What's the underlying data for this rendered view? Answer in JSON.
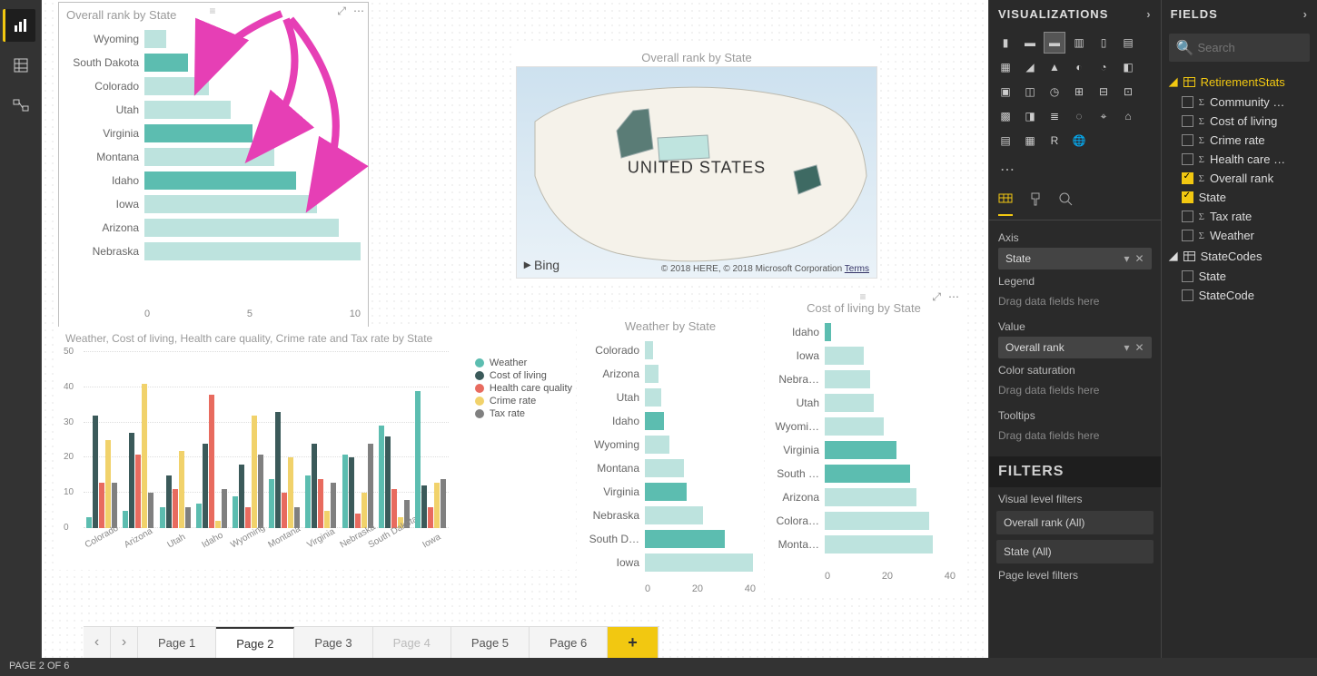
{
  "statusbar": {
    "text": "PAGE 2 OF 6"
  },
  "pages": {
    "items": [
      {
        "label": "Page 1",
        "active": false,
        "disabled": false
      },
      {
        "label": "Page 2",
        "active": true,
        "disabled": false
      },
      {
        "label": "Page 3",
        "active": false,
        "disabled": false
      },
      {
        "label": "Page 4",
        "active": false,
        "disabled": true
      },
      {
        "label": "Page 5",
        "active": false,
        "disabled": false
      },
      {
        "label": "Page 6",
        "active": false,
        "disabled": false
      }
    ],
    "add_label": "+"
  },
  "viz_panel": {
    "title": "VISUALIZATIONS",
    "axis_label": "Axis",
    "axis_field": "State",
    "legend_label": "Legend",
    "legend_placeholder": "Drag data fields here",
    "value_label": "Value",
    "value_field": "Overall rank",
    "sat_label": "Color saturation",
    "sat_placeholder": "Drag data fields here",
    "tooltips_label": "Tooltips",
    "tooltips_placeholder": "Drag data fields here",
    "filters_title": "FILTERS",
    "visual_filters_label": "Visual level filters",
    "filter1": "Overall rank (All)",
    "filter2": "State (All)",
    "page_filters_label": "Page level filters"
  },
  "fields_panel": {
    "title": "FIELDS",
    "search_placeholder": "Search",
    "table1": "RetirementStats",
    "table2": "StateCodes",
    "fields1": [
      {
        "name": "Community …",
        "checked": false,
        "sigma": true
      },
      {
        "name": "Cost of living",
        "checked": false,
        "sigma": true
      },
      {
        "name": "Crime rate",
        "checked": false,
        "sigma": true
      },
      {
        "name": "Health care …",
        "checked": false,
        "sigma": true
      },
      {
        "name": "Overall rank",
        "checked": true,
        "sigma": true
      },
      {
        "name": "State",
        "checked": true,
        "sigma": false
      },
      {
        "name": "Tax rate",
        "checked": false,
        "sigma": true
      },
      {
        "name": "Weather",
        "checked": false,
        "sigma": true
      }
    ],
    "fields2": [
      {
        "name": "State",
        "checked": false,
        "sigma": false
      },
      {
        "name": "StateCode",
        "checked": false,
        "sigma": false
      }
    ]
  },
  "map_viz": {
    "title": "Overall rank by State",
    "center_label": "UNITED STATES",
    "bing": "Bing",
    "attrib_prefix": "© 2018 HERE, © 2018 Microsoft Corporation ",
    "attrib_link": "Terms"
  },
  "chart_data": [
    {
      "id": "overall_rank",
      "type": "bar",
      "orientation": "horizontal",
      "title": "Overall rank by State",
      "xlim": [
        0,
        10
      ],
      "xticks": [
        0,
        5,
        10
      ],
      "categories": [
        "Wyoming",
        "South Dakota",
        "Colorado",
        "Utah",
        "Virginia",
        "Montana",
        "Idaho",
        "Iowa",
        "Arizona",
        "Nebraska"
      ],
      "values": [
        1.0,
        2.0,
        3.0,
        4.0,
        5.0,
        6.0,
        7.0,
        8.0,
        9.0,
        10.0
      ],
      "highlighted": [
        "South Dakota",
        "Virginia",
        "Idaho"
      ]
    },
    {
      "id": "multi_metrics",
      "type": "bar",
      "orientation": "vertical",
      "title": "Weather, Cost of living, Health care quality, Crime rate and Tax rate by State",
      "ylim": [
        0,
        50
      ],
      "yticks": [
        0,
        10,
        20,
        30,
        40,
        50
      ],
      "categories": [
        "Colorado",
        "Arizona",
        "Utah",
        "Idaho",
        "Wyoming",
        "Montana",
        "Virginia",
        "Nebraska",
        "South Dakota",
        "Iowa"
      ],
      "legend": [
        "Weather",
        "Cost of living",
        "Health care quality",
        "Crime rate",
        "Tax rate"
      ],
      "legend_colors": [
        "#5cbdb0",
        "#3b5a5a",
        "#e86b5f",
        "#f1d26b",
        "#808080"
      ],
      "series": [
        {
          "name": "Weather",
          "values": [
            3,
            5,
            6,
            7,
            9,
            14,
            15,
            21,
            29,
            39
          ]
        },
        {
          "name": "Cost of living",
          "values": [
            32,
            27,
            15,
            24,
            18,
            33,
            24,
            20,
            26,
            12
          ]
        },
        {
          "name": "Health care quality",
          "values": [
            13,
            21,
            11,
            38,
            6,
            10,
            14,
            4,
            11,
            6
          ]
        },
        {
          "name": "Crime rate",
          "values": [
            25,
            41,
            22,
            2,
            32,
            20,
            5,
            10,
            3,
            13
          ]
        },
        {
          "name": "Tax rate",
          "values": [
            13,
            10,
            6,
            11,
            21,
            6,
            13,
            24,
            8,
            14
          ]
        }
      ]
    },
    {
      "id": "weather_by_state",
      "type": "bar",
      "orientation": "horizontal",
      "title": "Weather by State",
      "xlim": [
        0,
        40
      ],
      "xticks": [
        0,
        20,
        40
      ],
      "categories": [
        "Colorado",
        "Arizona",
        "Utah",
        "Idaho",
        "Wyoming",
        "Montana",
        "Virginia",
        "Nebraska",
        "South D…",
        "Iowa"
      ],
      "values": [
        3,
        5,
        6,
        7,
        9,
        14,
        15,
        21,
        29,
        39
      ],
      "highlighted": [
        "Idaho",
        "Virginia",
        "South D…"
      ]
    },
    {
      "id": "cost_of_living_by_state",
      "type": "bar",
      "orientation": "horizontal",
      "title": "Cost of living by State",
      "xlim": [
        0,
        40
      ],
      "xticks": [
        0,
        20,
        40
      ],
      "categories": [
        "Idaho",
        "Iowa",
        "Nebra…",
        "Utah",
        "Wyomi…",
        "Virginia",
        "South …",
        "Arizona",
        "Colora…",
        "Monta…"
      ],
      "values": [
        2,
        12,
        14,
        15,
        18,
        22,
        26,
        28,
        32,
        33
      ],
      "highlighted": [
        "Idaho",
        "Virginia",
        "South …"
      ]
    }
  ]
}
